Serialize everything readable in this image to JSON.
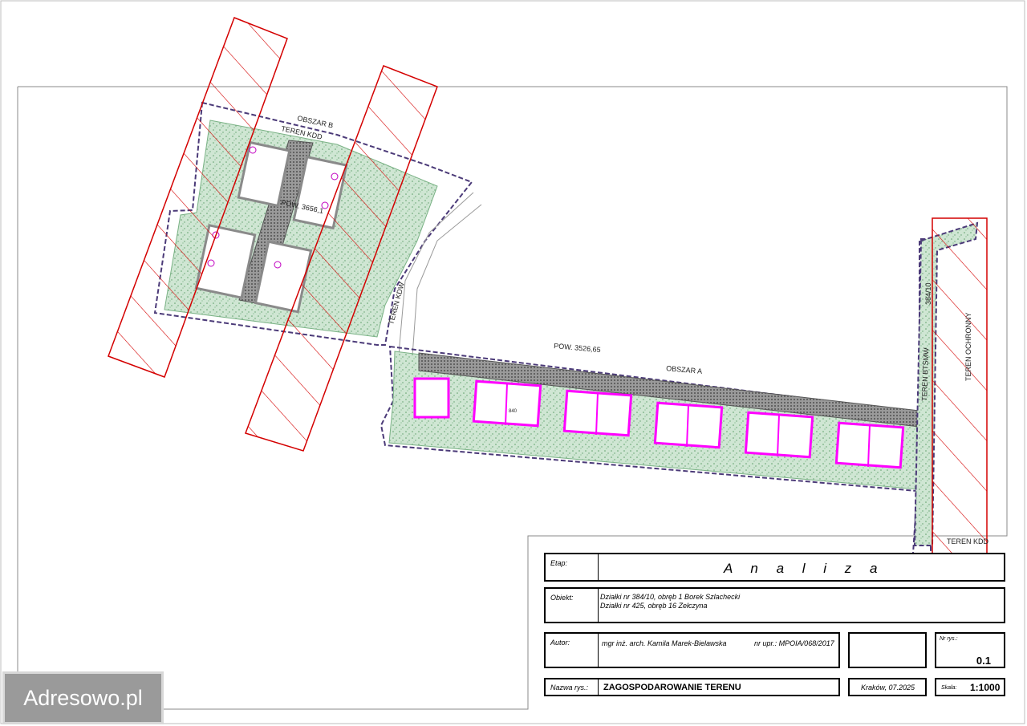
{
  "drawing": {
    "labels": {
      "area_b": "OBSZAR B",
      "area_a": "OBSZAR A",
      "teren_kdd_top": "TEREN KDD",
      "teren_kdd_bottom": "TEREN KDD",
      "pow_a": "POW. 3526,65",
      "pow_b": "POW. 3656,1",
      "teren_kdw": "TEREN KDW",
      "teren_btsmw": "TEREN BTSMW",
      "teren_ochronny": "TEREN OCHRONNY",
      "parcel_384": "384/10",
      "dim": "840"
    },
    "colors": {
      "hatch": "#d40000",
      "boundary": "#4b3a78",
      "green": "#9cc9a6",
      "building": "#ff00ff",
      "road": "#6e6e6e"
    }
  },
  "title_block": {
    "etap_label": "Etap:",
    "etap_value": "A n a l i z a",
    "obiekt_label": "Obiekt:",
    "obiekt_line1": "Działki  nr 384/10, obręb 1 Borek Szlachecki",
    "obiekt_line2": "Działki  nr 425, obręb 16 Zełczyna",
    "autor_label": "Autor:",
    "autor_value": "mgr inż. arch. Kamila Marek-Bielawska",
    "nr_upr": "nr upr.: MPOIA/068/2017",
    "nr_rys_label": "Nr rys.:",
    "nr_rys_value": "0.1",
    "nazwa_label": "Nazwa rys.:",
    "nazwa_value": "ZAGOSPODAROWANIE TERENU",
    "miejsce_data": "Kraków, 07.2025",
    "skala_label": "Skala:",
    "skala_value": "1:1000"
  },
  "watermark": "Adresowo.pl"
}
